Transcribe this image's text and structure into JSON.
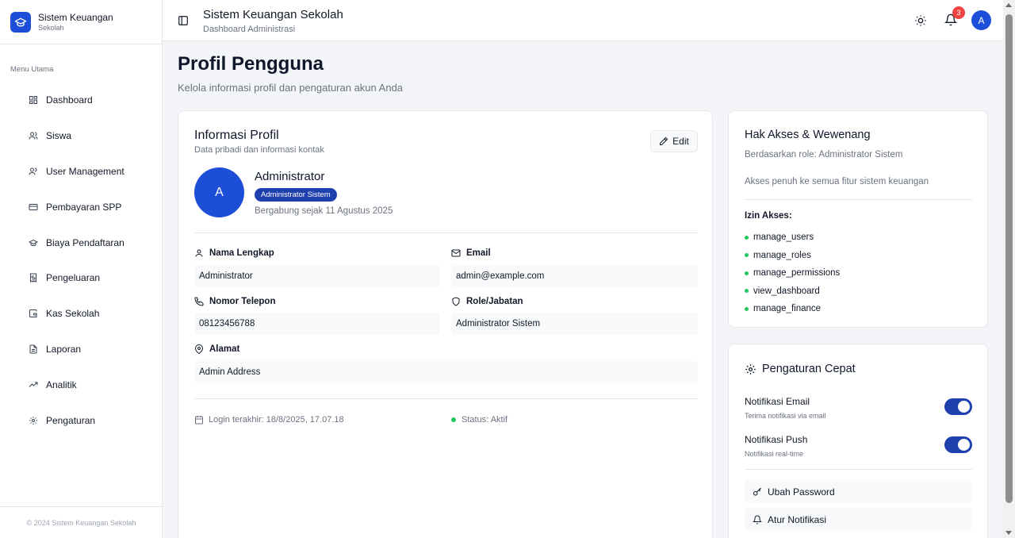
{
  "brand": {
    "title": "Sistem Keuangan",
    "subtitle": "Sekolah"
  },
  "sidebar": {
    "menu_label": "Menu Utama",
    "items": [
      {
        "label": "Dashboard",
        "icon": "dashboard-icon"
      },
      {
        "label": "Siswa",
        "icon": "users-icon"
      },
      {
        "label": "User Management",
        "icon": "user-management-icon"
      },
      {
        "label": "Pembayaran SPP",
        "icon": "credit-card-icon"
      },
      {
        "label": "Biaya Pendaftaran",
        "icon": "graduation-cap-icon"
      },
      {
        "label": "Pengeluaran",
        "icon": "receipt-icon"
      },
      {
        "label": "Kas Sekolah",
        "icon": "wallet-icon"
      },
      {
        "label": "Laporan",
        "icon": "file-text-icon"
      },
      {
        "label": "Analitik",
        "icon": "trending-up-icon"
      },
      {
        "label": "Pengaturan",
        "icon": "gear-icon"
      }
    ],
    "footer": "© 2024 Sistem Keuangan Sekolah"
  },
  "header": {
    "title": "Sistem Keuangan Sekolah",
    "subtitle": "Dashboard Administrasi",
    "notification_count": "3",
    "avatar_initial": "A"
  },
  "page": {
    "title": "Profil Pengguna",
    "subtitle": "Kelola informasi profil dan pengaturan akun Anda"
  },
  "profile": {
    "card_title": "Informasi Profil",
    "card_desc": "Data pribadi dan informasi kontak",
    "edit_label": "Edit",
    "avatar_initial": "A",
    "name": "Administrator",
    "role_badge": "Administrator Sistem",
    "joined": "Bergabung sejak 11 Agustus 2025",
    "fields": {
      "full_name": {
        "label": "Nama Lengkap",
        "value": "Administrator"
      },
      "email": {
        "label": "Email",
        "value": "admin@example.com"
      },
      "phone": {
        "label": "Nomor Telepon",
        "value": "08123456788"
      },
      "role": {
        "label": "Role/Jabatan",
        "value": "Administrator Sistem"
      },
      "address": {
        "label": "Alamat",
        "value": "Admin Address"
      }
    },
    "last_login": "Login terakhir: 18/8/2025, 17.07.18",
    "status": "Status: Aktif"
  },
  "access": {
    "title": "Hak Akses & Wewenang",
    "role_line": "Berdasarkan role: Administrator Sistem",
    "description": "Akses penuh ke semua fitur sistem keuangan",
    "permissions_label": "Izin Akses:",
    "permissions": [
      "manage_users",
      "manage_roles",
      "manage_permissions",
      "view_dashboard",
      "manage_finance"
    ]
  },
  "settings": {
    "title": "Pengaturan Cepat",
    "email_notif": {
      "title": "Notifikasi Email",
      "desc": "Terima notifikasi via email",
      "enabled": true
    },
    "push_notif": {
      "title": "Notifikasi Push",
      "desc": "Notifikasi real-time",
      "enabled": true
    },
    "change_password": "Ubah Password",
    "notif_settings": "Atur Notifikasi"
  },
  "colors": {
    "primary": "#1d4ed8",
    "badge": "#1e40af",
    "notification": "#ef4444",
    "status_active": "#22c55e"
  }
}
